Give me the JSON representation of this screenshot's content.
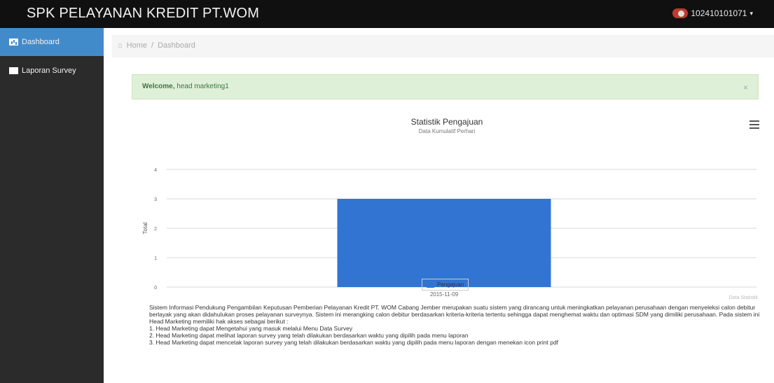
{
  "app": {
    "title": "SPK PELAYANAN KREDIT PT.WOM",
    "user": "102410101071"
  },
  "sidebar": {
    "items": [
      {
        "label": "Dashboard"
      },
      {
        "label": "Laporan Survey"
      }
    ]
  },
  "breadcrumb": {
    "home": "Home",
    "sep": "/",
    "current": "Dashboard"
  },
  "alert": {
    "strong": "Welcome,",
    "text": "head marketing1",
    "close": "×"
  },
  "chart": {
    "menu_icon": "hamburger-menu-icon",
    "credits": "Data Statistik"
  },
  "chart_data": {
    "type": "bar",
    "title": "Statistik Pengajuan",
    "subtitle": "Data Kumulatif Perhari",
    "xlabel": "",
    "ylabel": "Total",
    "categories": [
      "2015-11-09"
    ],
    "series": [
      {
        "name": "Pengajuan",
        "values": [
          3
        ],
        "color": "#3274d2"
      }
    ],
    "ylim": [
      0,
      4
    ],
    "yticks": [
      0,
      1,
      2,
      3,
      4
    ],
    "grid": true,
    "legend": "bottom-center"
  },
  "description": {
    "paragraph": "Sistem Informasi Pendukung Pengambilan Keputusan Pemberian Pelayanan Kredit PT. WOM Cabang Jember merupakan suatu sistem yang dirancang untuk meningkatkan pelayanan perusahaan dengan menyeleksi calon debitur berlayak yang akan didahulukan proses pelayanan surveynya. Sistem ini merangking calon debitur berdasarkan kriteria-kriteria tertentu sehingga dapat menghemat waktu dan optimasi SDM yang dimiliki perusahaan. Pada sistem ini Head Marketing memiliki hak akses sebagai berikut :",
    "items": [
      "1. Head Marketing dapat Mengetahui yang masuk melalui Menu Data Survey",
      "2. Head Marketing dapat melihat laporan survey yang telah dilakukan berdasarkan waktu yang dipilih pada menu laporan",
      "3. Head Marketing dapat mencetak laporan survey yang telah dilakukan berdasarkan waktu yang dipilih pada menu laporan dengan menekan icon print pdf"
    ]
  }
}
